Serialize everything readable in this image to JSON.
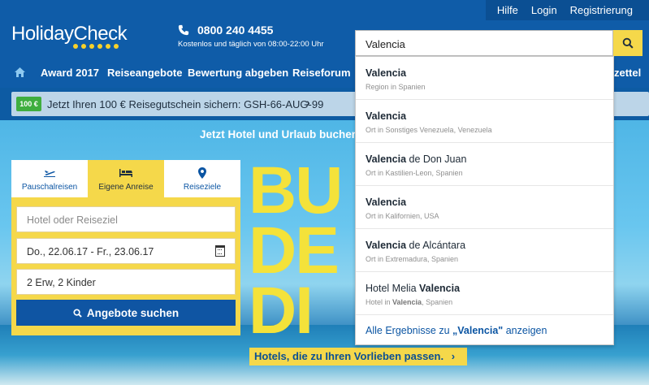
{
  "header": {
    "logo": "HolidayCheck",
    "phone_number": "0800 240 4455",
    "phone_hours": "Kostenlos und täglich von 08:00-22:00 Uhr",
    "top_links": [
      "Hilfe",
      "Login",
      "Registrierung"
    ],
    "search_value": "Valencia"
  },
  "nav": {
    "items": [
      "Award 2017",
      "Reiseangebote",
      "Bewertung abgeben",
      "Reiseforum",
      "zettel"
    ]
  },
  "voucher": {
    "badge": "100 €",
    "text": "Jetzt Ihren 100 € Reisegutschein sichern: GSH-66-AUG-99"
  },
  "hero": {
    "title": "Jetzt Hotel und Urlaub buchen",
    "big_text": [
      "BU",
      "DE",
      "DI"
    ],
    "cta": "Hotels, die zu Ihren Vorlieben passen."
  },
  "search_panel": {
    "tabs": [
      "Pauschalreisen",
      "Eigene Anreise",
      "Reiseziele"
    ],
    "hotel_placeholder": "Hotel oder Reiseziel",
    "dates": "Do., 22.06.17 - Fr., 23.06.17",
    "travelers": "2 Erw, 2 Kinder",
    "button": "Angebote suchen"
  },
  "dropdown": {
    "items": [
      {
        "bold": "Valencia",
        "rest": "",
        "prefix": "",
        "sub": "Region in Spanien"
      },
      {
        "bold": "Valencia",
        "rest": "",
        "prefix": "",
        "sub": "Ort in Sonstiges Venezuela, Venezuela"
      },
      {
        "bold": "Valencia",
        "rest": " de Don Juan",
        "prefix": "",
        "sub": "Ort in Kastilien-Leon, Spanien"
      },
      {
        "bold": "Valencia",
        "rest": "",
        "prefix": "",
        "sub": "Ort in Kalifornien, USA"
      },
      {
        "bold": "Valencia",
        "rest": " de Alcántara",
        "prefix": "",
        "sub": "Ort in Extremadura, Spanien"
      },
      {
        "bold": "Valencia",
        "rest": "",
        "prefix": "Hotel Melia ",
        "sub_prefix": "Hotel in ",
        "sub_bold": "Valencia",
        "sub_rest": ", Spanien"
      }
    ],
    "all_prefix": "Alle Ergebnisse zu ",
    "all_bold": "„Valencia\"",
    "all_suffix": " anzeigen"
  },
  "colors": {
    "brand_blue": "#0f5ca8",
    "accent_yellow": "#f5d84a"
  }
}
